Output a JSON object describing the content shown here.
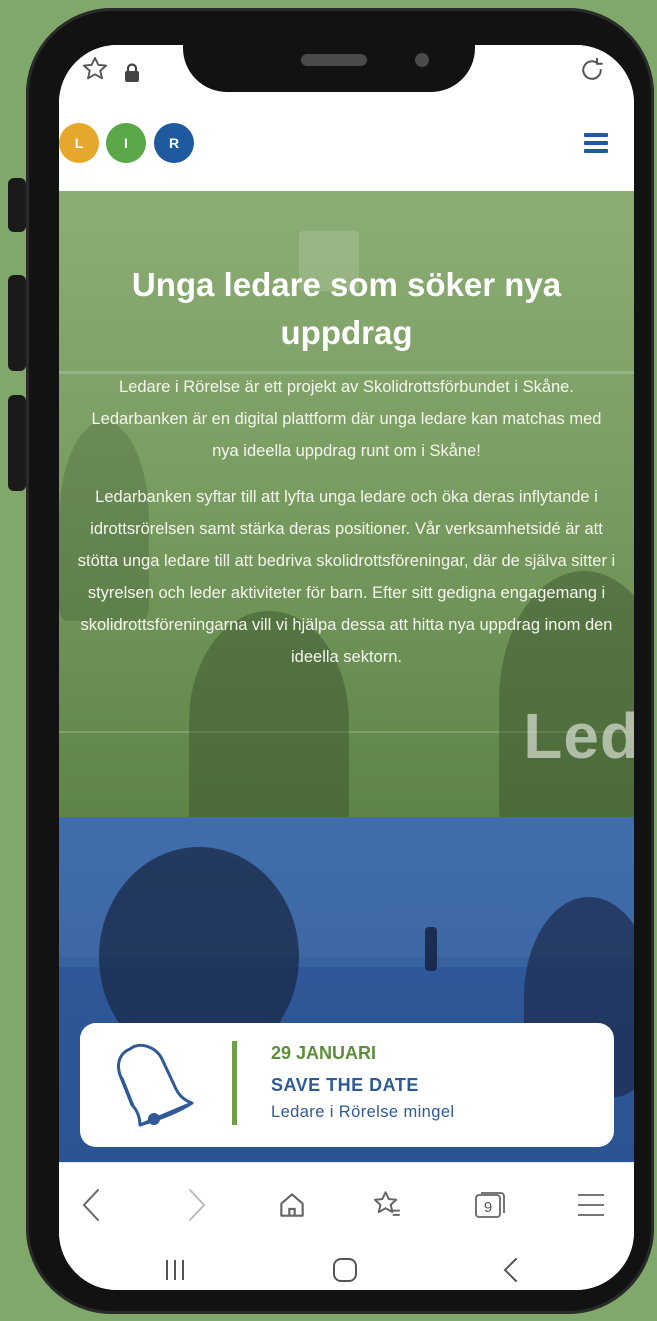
{
  "browser": {
    "reload_label": "↻",
    "tab_count": "9"
  },
  "site": {
    "logo_letters": [
      "L",
      "I",
      "R"
    ],
    "logo_colors": [
      "#e6a82a",
      "#5aa847",
      "#1f5a9e"
    ]
  },
  "hero": {
    "title": "Unga ledare som söker nya uppdrag",
    "paragraph_1": "Ledare i Rörelse är ett projekt av Skolidrottsförbundet i Skåne. Ledarbanken är en digital plattform där unga ledare kan matchas med nya ideella uppdrag runt om i Skåne!",
    "paragraph_2": "Ledarbanken syftar till att lyfta unga ledare och öka deras inflytande i idrottsrörelsen samt stärka deras positioner. Vår verksamhetsidé är att stötta unga ledare till att bedriva skolidrottsföreningar, där de själva sitter i styrelsen och leder aktiviteter för barn. Efter sitt gedigna engagemang i skolidrottsföreningarna vill vi hjälpa dessa att hitta nya uppdrag inom den ideella sektorn.",
    "watermark": "Led"
  },
  "event": {
    "date": "29 JANUARI",
    "title": "SAVE THE DATE",
    "subtitle": "Ledare i Rörelse mingel"
  },
  "colors": {
    "brand_blue": "#1f5a9e",
    "brand_green": "#5e8e3d",
    "hero_overlay": "#7fa86a",
    "photo_overlay": "#2f5a95"
  }
}
